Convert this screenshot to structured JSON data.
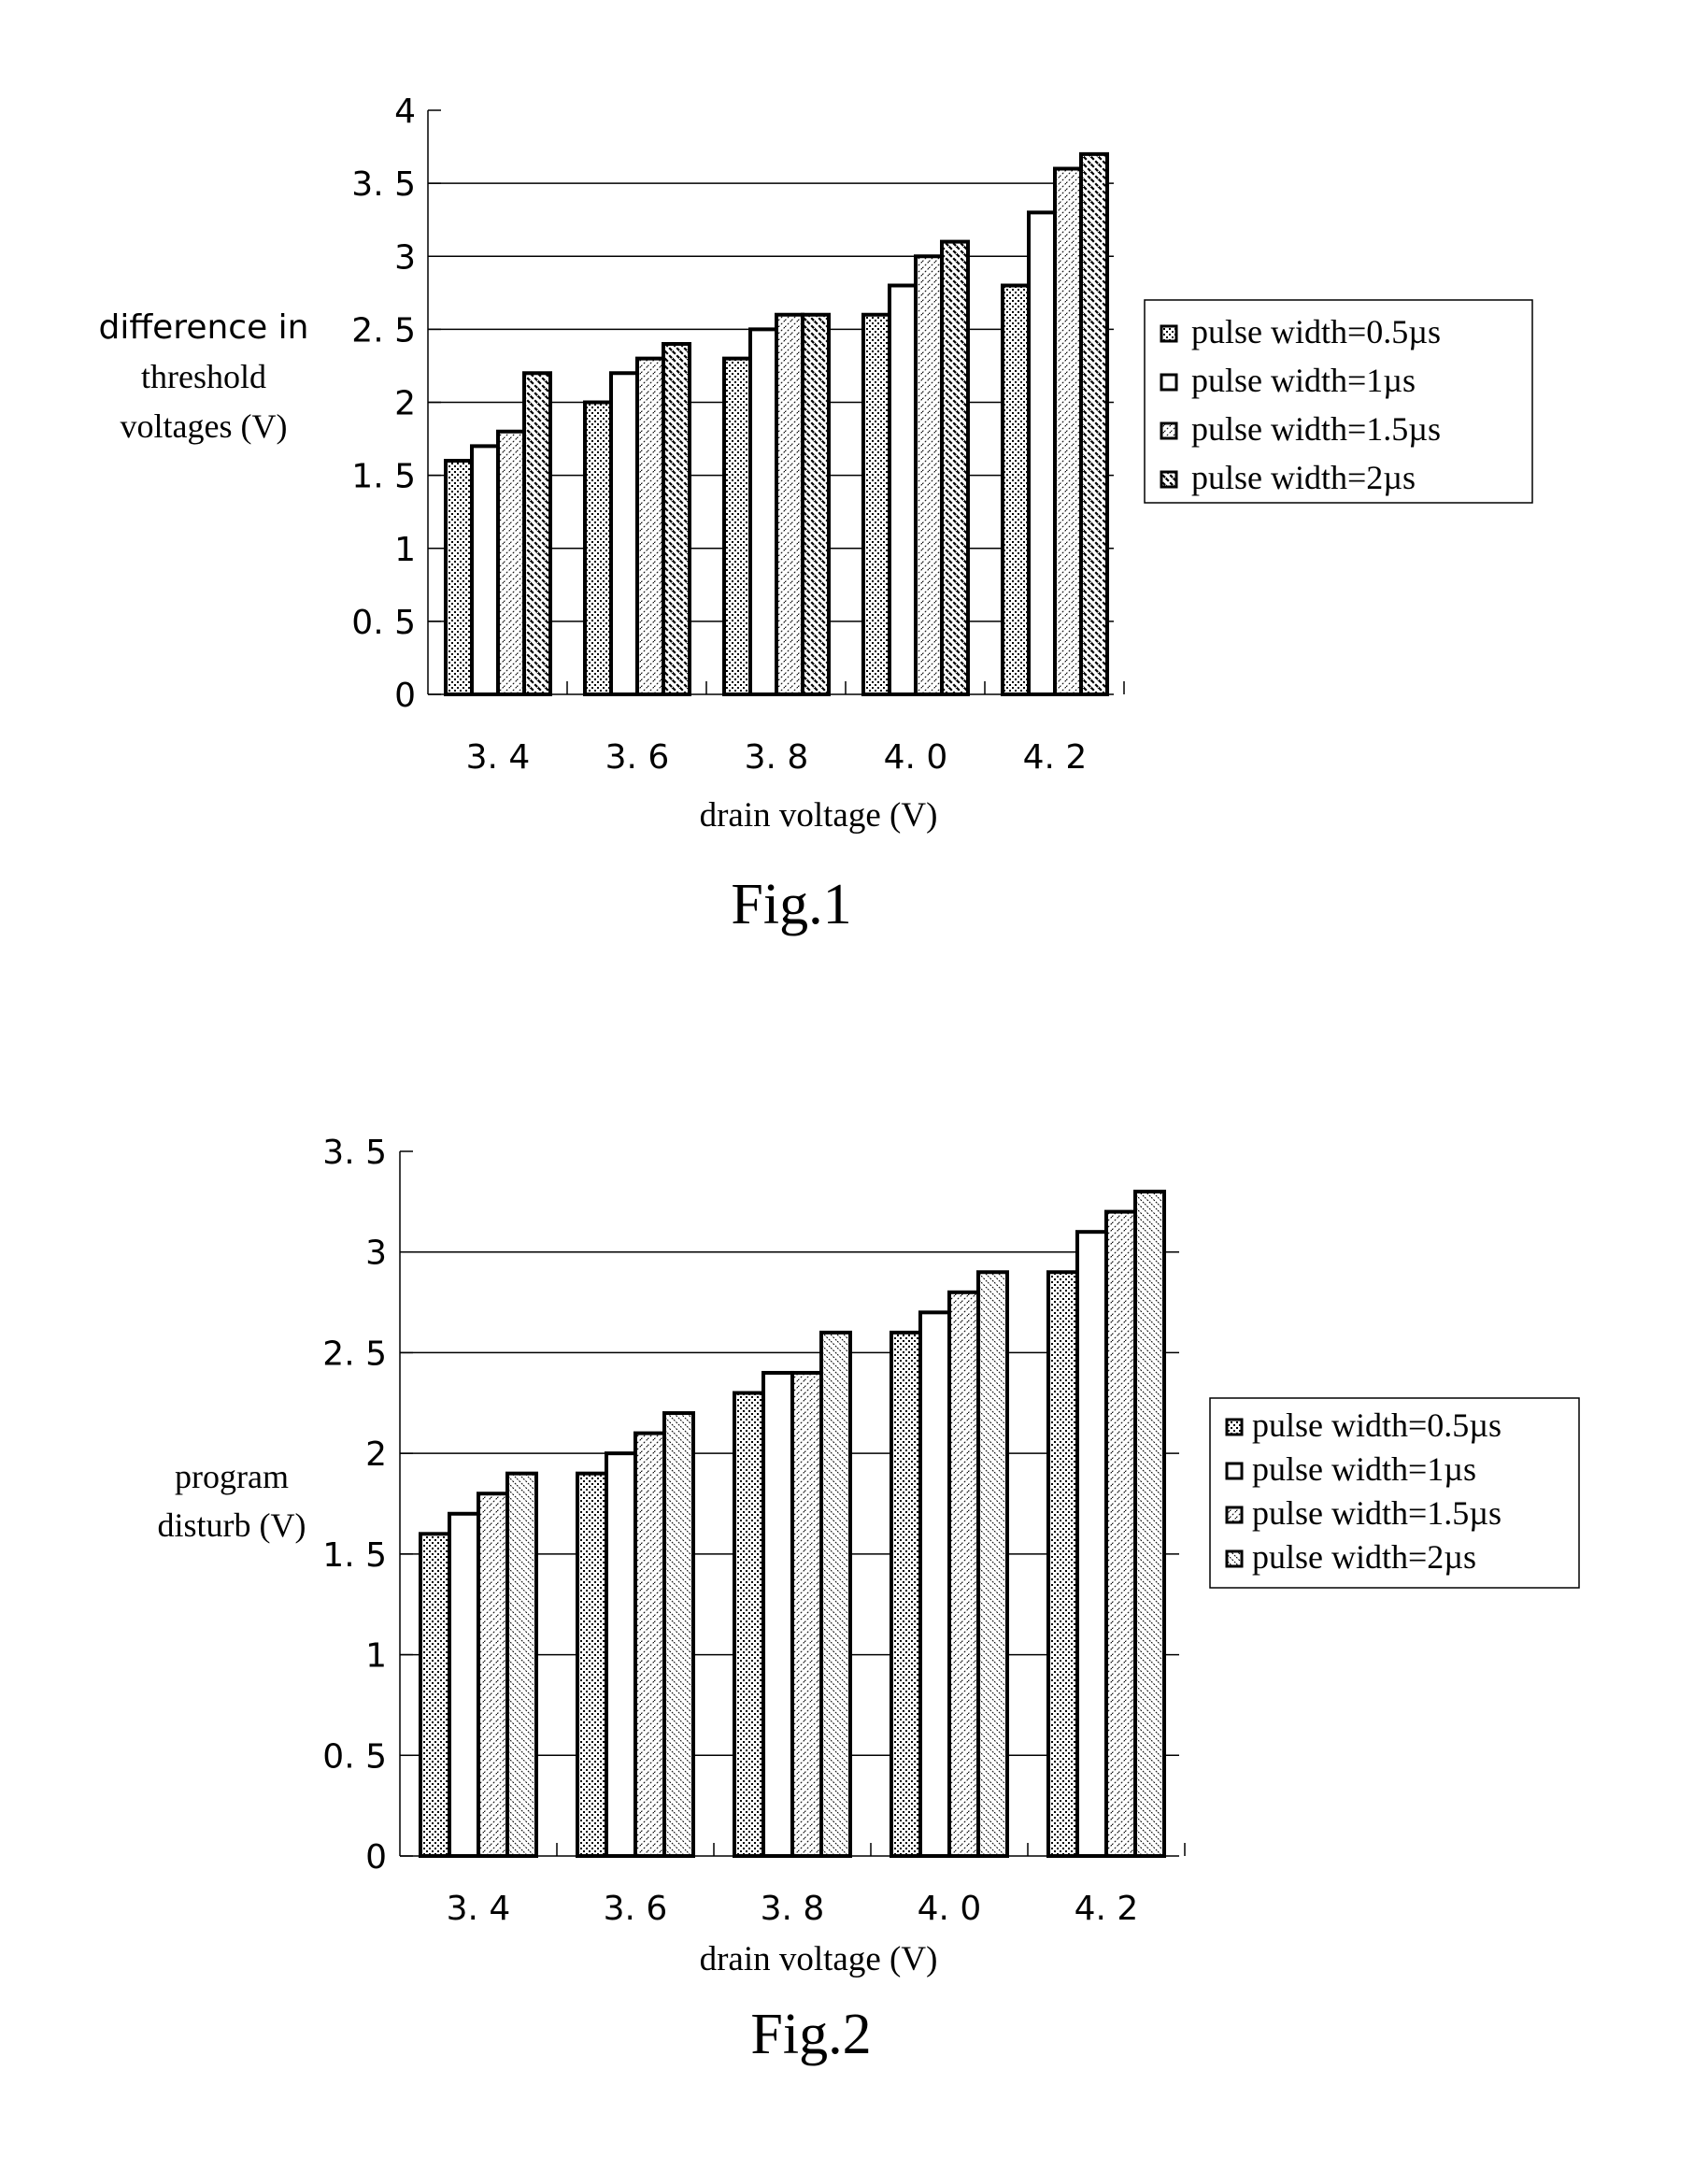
{
  "chart_data": [
    {
      "type": "bar",
      "figure_label": "Fig.1",
      "title": "",
      "ylabel_lines": [
        "difference in",
        "threshold",
        "voltages (V)"
      ],
      "xlabel": "drain voltage (V)",
      "ylim": [
        0,
        4
      ],
      "yticks": [
        0,
        0.5,
        1,
        1.5,
        2,
        2.5,
        3,
        3.5,
        4
      ],
      "ytick_labels": [
        "0",
        "0. 5",
        "1",
        "1. 5",
        "2",
        "2. 5",
        "3",
        "3. 5",
        "4"
      ],
      "categories": [
        "3. 4",
        "3. 6",
        "3. 8",
        "4. 0",
        "4. 2"
      ],
      "grid": true,
      "legend_position": "right",
      "series": [
        {
          "name": "pulse width=0.5µs",
          "pattern": "dots",
          "values": [
            1.6,
            2.0,
            2.3,
            2.6,
            2.8
          ]
        },
        {
          "name": "pulse width=1µs",
          "pattern": "none",
          "values": [
            1.7,
            2.2,
            2.5,
            2.8,
            3.3
          ]
        },
        {
          "name": "pulse width=1.5µs",
          "pattern": "fine-diagonal",
          "values": [
            1.8,
            2.3,
            2.6,
            3.0,
            3.6
          ]
        },
        {
          "name": "pulse width=2µs",
          "pattern": "bold-backslash",
          "values": [
            2.2,
            2.4,
            2.6,
            3.1,
            3.7
          ]
        }
      ]
    },
    {
      "type": "bar",
      "figure_label": "Fig.2",
      "title": "",
      "ylabel_lines": [
        "program",
        "disturb (V)"
      ],
      "xlabel": "drain voltage (V)",
      "ylim": [
        0,
        3.5
      ],
      "yticks": [
        0,
        0.5,
        1,
        1.5,
        2,
        2.5,
        3,
        3.5
      ],
      "ytick_labels": [
        "0",
        "0. 5",
        "1",
        "1. 5",
        "2",
        "2. 5",
        "3",
        "3. 5"
      ],
      "categories": [
        "3. 4",
        "3. 6",
        "3. 8",
        "4. 0",
        "4. 2"
      ],
      "grid": true,
      "legend_position": "right",
      "series": [
        {
          "name": "pulse width=0.5µs",
          "pattern": "dots",
          "values": [
            1.6,
            1.9,
            2.3,
            2.6,
            2.9
          ]
        },
        {
          "name": "pulse width=1µs",
          "pattern": "none",
          "values": [
            1.7,
            2.0,
            2.4,
            2.7,
            3.1
          ]
        },
        {
          "name": "pulse width=1.5µs",
          "pattern": "fine-diagonal",
          "values": [
            1.8,
            2.1,
            2.4,
            2.8,
            3.2
          ]
        },
        {
          "name": "pulse width=2µs",
          "pattern": "fine-backslash",
          "values": [
            1.9,
            2.2,
            2.6,
            2.9,
            3.3
          ]
        }
      ]
    }
  ]
}
